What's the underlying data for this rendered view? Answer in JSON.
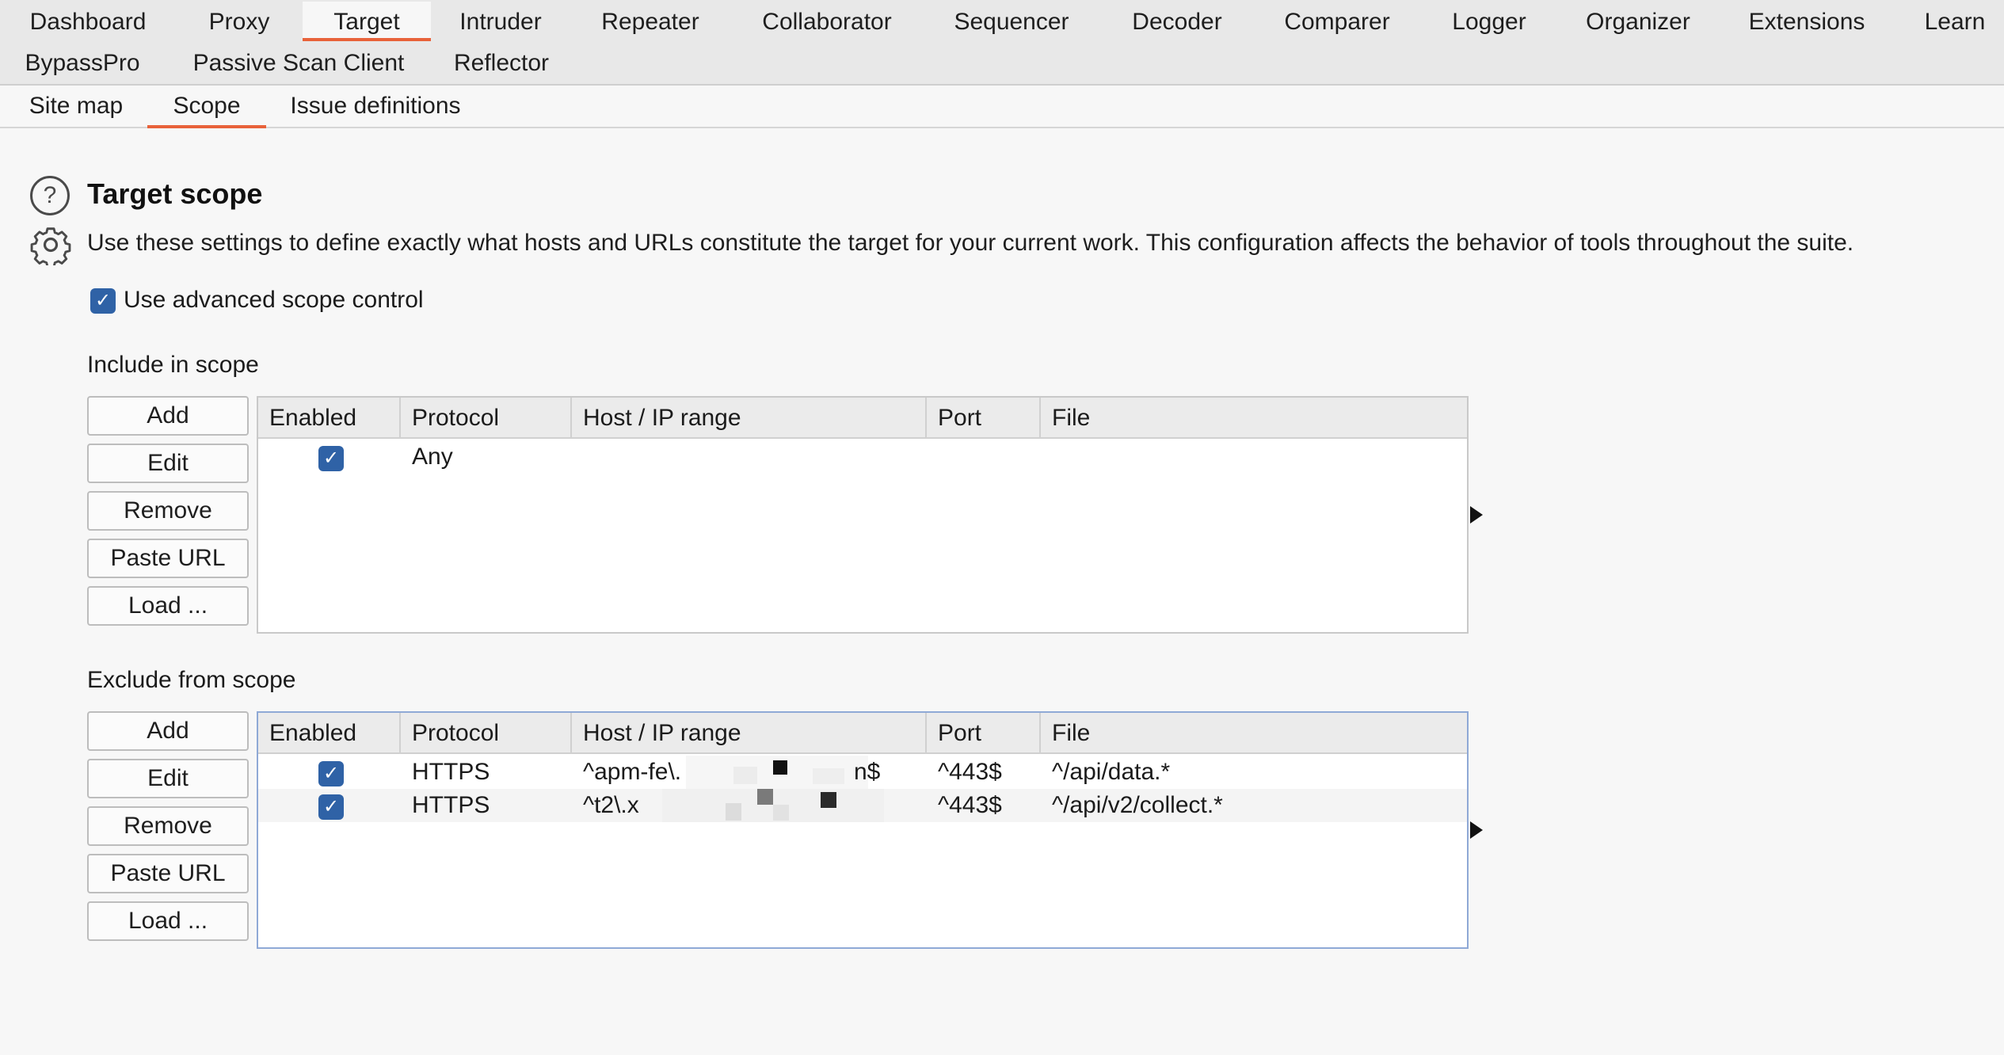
{
  "tabs": {
    "row1": [
      "Dashboard",
      "Proxy",
      "Target",
      "Intruder",
      "Repeater",
      "Collaborator",
      "Sequencer",
      "Decoder",
      "Comparer",
      "Logger",
      "Organizer",
      "Extensions",
      "Learn"
    ],
    "row2": [
      "BypassPro",
      "Passive Scan Client",
      "Reflector"
    ],
    "active": "Target"
  },
  "subtabs": {
    "items": [
      "Site map",
      "Scope",
      "Issue definitions"
    ],
    "active": "Scope"
  },
  "header": {
    "title": "Target scope",
    "description": "Use these settings to define exactly what hosts and URLs constitute the target for your current work. This configuration affects the behavior of tools throughout the suite.",
    "help_icon": "?"
  },
  "advanced_scope": {
    "label": "Use advanced scope control",
    "checked": true
  },
  "buttons": {
    "add": "Add",
    "edit": "Edit",
    "remove": "Remove",
    "paste_url": "Paste URL",
    "load": "Load ..."
  },
  "columns": [
    "Enabled",
    "Protocol",
    "Host / IP range",
    "Port",
    "File"
  ],
  "include": {
    "label": "Include in scope",
    "rows": [
      {
        "enabled": true,
        "protocol": "Any",
        "host": "",
        "port": "",
        "file": ""
      }
    ]
  },
  "exclude": {
    "label": "Exclude from scope",
    "rows": [
      {
        "enabled": true,
        "protocol": "HTTPS",
        "host_prefix": "^apm-fe\\.",
        "host_suffix": "n$",
        "port": "^443$",
        "file": "^/api/data.*"
      },
      {
        "enabled": true,
        "protocol": "HTTPS",
        "host_prefix": "^t2\\.x",
        "host_suffix": "",
        "port": "^443$",
        "file": "^/api/v2/collect.*"
      }
    ]
  },
  "colors": {
    "accent": "#e8623a",
    "checkbox": "#2f62a6",
    "tab_bar": "#e8e8e8"
  }
}
